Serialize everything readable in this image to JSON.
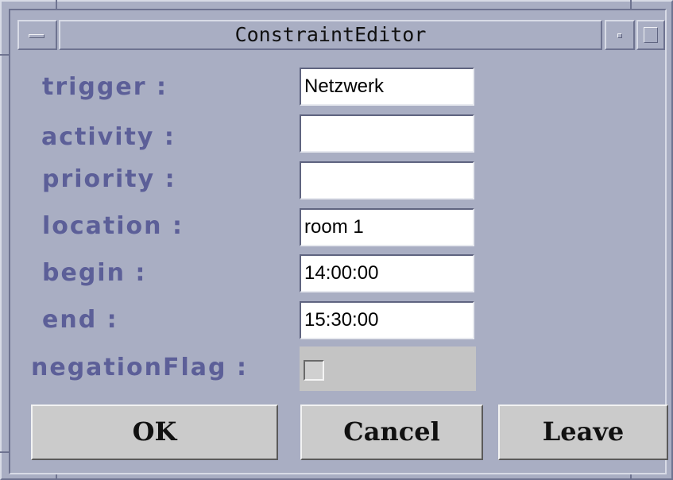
{
  "window": {
    "title": "ConstraintEditor",
    "menu_icon": "window-menu-icon",
    "minimize_icon": "minimize-icon",
    "maximize_icon": "maximize-icon"
  },
  "form": {
    "labels": {
      "trigger": "trigger :",
      "activity": "activity :",
      "priority": "priority :",
      "location": "location :",
      "begin": "begin :",
      "end": "end :",
      "negationFlag": "negationFlag :"
    },
    "values": {
      "trigger": "Netzwerk",
      "activity": "",
      "priority": "",
      "location": "room 1",
      "begin": "14:00:00",
      "end": "15:30:00",
      "negationFlag": false
    }
  },
  "buttons": {
    "ok": "OK",
    "cancel": "Cancel",
    "leave": "Leave"
  },
  "colors": {
    "background": "#a9aec3",
    "label_text": "#5c5f98",
    "button_face": "#cbcbcb",
    "flag_area": "#c4c4c4"
  }
}
